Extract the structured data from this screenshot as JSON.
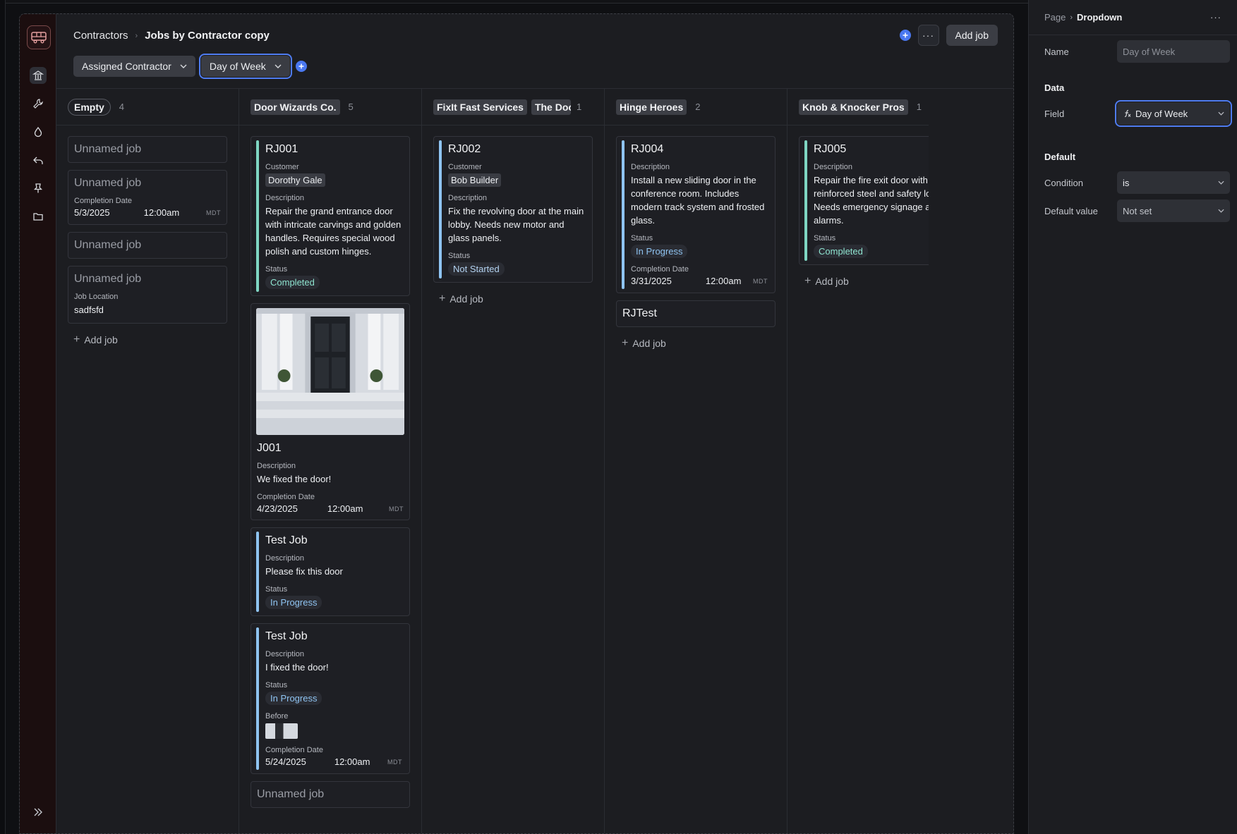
{
  "breadcrumb": {
    "root": "Contractors",
    "current": "Jobs by Contractor copy"
  },
  "filters": [
    "Assigned Contractor",
    "Day of Week"
  ],
  "toolbar": {
    "more": "···",
    "add_job": "Add job"
  },
  "columns": [
    {
      "tags": [
        "Empty"
      ],
      "count": "4",
      "add_label": "Add job",
      "cards": [
        {
          "title": "Unnamed job"
        },
        {
          "title": "Unnamed job",
          "completion_label": "Completion Date",
          "date": "5/3/2025",
          "time": "12:00am",
          "tz": "MDT"
        },
        {
          "title": "Unnamed job"
        },
        {
          "title": "Unnamed job",
          "location_label": "Job Location",
          "location": "sadfsfd"
        }
      ]
    },
    {
      "tags": [
        "Door Wizards Co."
      ],
      "count": "5",
      "cards": [
        {
          "title": "RJ001",
          "customer_label": "Customer",
          "customer": "Dorothy Gale",
          "desc_label": "Description",
          "desc": "Repair the grand entrance door with intricate carvings and golden handles. Requires special wood polish and custom hinges.",
          "status_label": "Status",
          "status": "Completed"
        },
        {
          "title": "J001",
          "desc_label": "Description",
          "desc": "We fixed the door!",
          "completion_label": "Completion Date",
          "date": "4/23/2025",
          "time": "12:00am",
          "tz": "MDT"
        },
        {
          "title": "Test Job",
          "desc_label": "Description",
          "desc": "Please fix this door",
          "status_label": "Status",
          "status": "In Progress"
        },
        {
          "title": "Test Job",
          "desc_label": "Description",
          "desc": "I fixed the door!",
          "status_label": "Status",
          "status": "In Progress",
          "before_label": "Before",
          "completion_label": "Completion Date",
          "date": "5/24/2025",
          "time": "12:00am",
          "tz": "MDT"
        },
        {
          "title": "Unnamed job"
        }
      ]
    },
    {
      "tags": [
        "FixIt Fast Services",
        "The Door"
      ],
      "count": "1",
      "add_label": "Add job",
      "cards": [
        {
          "title": "RJ002",
          "customer_label": "Customer",
          "customer": "Bob Builder",
          "desc_label": "Description",
          "desc": "Fix the revolving door at the main lobby. Needs new motor and glass panels.",
          "status_label": "Status",
          "status": "Not Started"
        }
      ]
    },
    {
      "tags": [
        "Hinge Heroes"
      ],
      "count": "2",
      "add_label": "Add job",
      "cards": [
        {
          "title": "RJ004",
          "desc_label": "Description",
          "desc": "Install a new sliding door in the conference room. Includes modern track system and frosted glass.",
          "status_label": "Status",
          "status": "In Progress",
          "completion_label": "Completion Date",
          "date": "3/31/2025",
          "time": "12:00am",
          "tz": "MDT"
        },
        {
          "title": "RJTest"
        }
      ]
    },
    {
      "tags": [
        "Knob & Knocker Pros"
      ],
      "count": "1",
      "add_label": "Add job",
      "cards": [
        {
          "title": "RJ005",
          "desc_label": "Description",
          "desc": "Repair the fire exit door with reinforced steel and safety locks. Needs emergency signage and alarms.",
          "status_label": "Status",
          "status": "Completed"
        }
      ]
    }
  ],
  "panel": {
    "breadcrumb_root": "Page",
    "breadcrumb_current": "Dropdown",
    "more": "···",
    "name_label": "Name",
    "name_placeholder": "Day of Week",
    "data_section": "Data",
    "field_label": "Field",
    "field_value": "Day of Week",
    "default_section": "Default",
    "condition_label": "Condition",
    "condition_value": "is",
    "default_value_label": "Default value",
    "default_value": "Not set"
  },
  "colors": {
    "accent": "#4f7cf0",
    "completed": "#8ee3cf",
    "in_progress": "#8fc4f2",
    "rail": "#1b0e0f"
  },
  "icons": [
    "bus-icon",
    "building-icon",
    "wrench-icon",
    "drop-icon",
    "reply-icon",
    "pin-icon",
    "folder-icon",
    "chevrons-right-icon",
    "plus-icon",
    "chevron-down-icon",
    "formula-icon"
  ]
}
